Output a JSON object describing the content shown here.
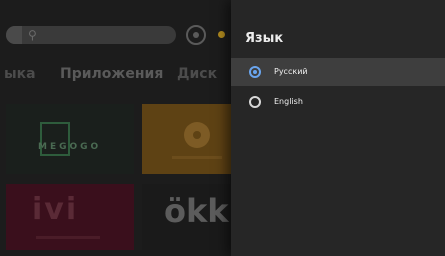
{
  "background": {
    "search": {
      "icon": "search-icon"
    },
    "top_icons": [
      "settings-icon",
      "status-dot"
    ],
    "nav_tabs": [
      "ыка",
      "Приложения",
      "Диск"
    ],
    "tiles": {
      "megogo": {
        "label": "MEGOGO",
        "color": "#2e5c3c"
      },
      "ivi": {
        "label": "ivi",
        "color": "#5a2a36"
      },
      "okko": {
        "label": "ökk",
        "color": "#5c5c5c"
      },
      "orange_reel": {
        "icon": "film-reel-icon",
        "color": "#7d5b25"
      }
    }
  },
  "panel": {
    "title": "Язык",
    "options": [
      {
        "label": "Русский",
        "selected": true,
        "icon": "radio-checked-icon"
      },
      {
        "label": "English",
        "selected": false,
        "icon": "radio-unchecked-icon"
      }
    ],
    "accent_color": "#6aa5ee"
  }
}
